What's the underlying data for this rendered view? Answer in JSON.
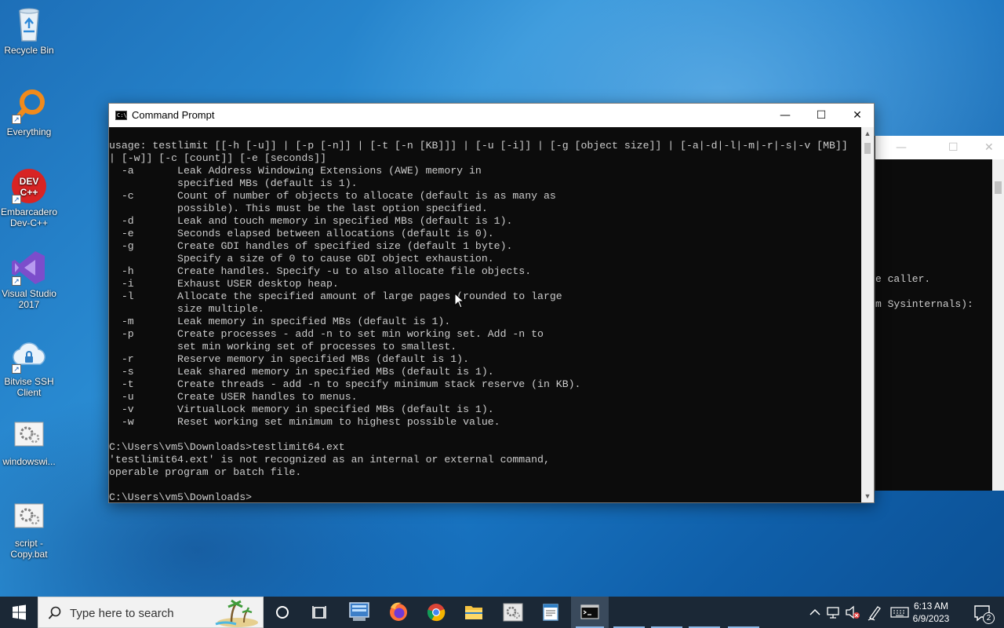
{
  "desktop": {
    "icons": [
      {
        "label": "Recycle Bin",
        "icon": "recycle-bin-icon"
      },
      {
        "label": "Everything",
        "icon": "everything-search-icon"
      },
      {
        "label": "Embarcadero Dev-C++",
        "icon": "dev-cpp-icon",
        "badge": "DEV C++"
      },
      {
        "label": "Visual Studio 2017",
        "icon": "visual-studio-icon"
      },
      {
        "label": "Bitvise SSH Client",
        "icon": "bitvise-ssh-icon"
      },
      {
        "label": "windowswi...",
        "icon": "batch-file-icon"
      },
      {
        "label": "script - Copy.bat",
        "icon": "batch-file-icon"
      }
    ]
  },
  "background_window": {
    "minimize_glyph": "—",
    "maximize_glyph": "☐",
    "close_glyph": "✕",
    "visible_text": [
      "e caller.",
      "m Sysinternals):"
    ]
  },
  "cmd_window": {
    "title": "Command Prompt",
    "minimize_glyph": "—",
    "maximize_glyph": "☐",
    "close_glyph": "✕",
    "lines": [
      "usage: testlimit [[-h [-u]] | [-p [-n]] | [-t [-n [KB]]] | [-u [-i]] | [-g [object size]] | [-a|-d|-l|-m|-r|-s|-v [MB]]",
      "| [-w]] [-c [count]] [-e [seconds]]",
      "  -a       Leak Address Windowing Extensions (AWE) memory in",
      "           specified MBs (default is 1).",
      "  -c       Count of number of objects to allocate (default is as many as",
      "           possible). This must be the last option specified.",
      "  -d       Leak and touch memory in specified MBs (default is 1).",
      "  -e       Seconds elapsed between allocations (default is 0).",
      "  -g       Create GDI handles of specified size (default 1 byte).",
      "           Specify a size of 0 to cause GDI object exhaustion.",
      "  -h       Create handles. Specify -u to also allocate file objects.",
      "  -i       Exhaust USER desktop heap.",
      "  -l       Allocate the specified amount of large pages (rounded to large",
      "           size multiple.",
      "  -m       Leak memory in specified MBs (default is 1).",
      "  -p       Create processes - add -n to set min working set. Add -n to",
      "           set min working set of processes to smallest.",
      "  -r       Reserve memory in specified MBs (default is 1).",
      "  -s       Leak shared memory in specified MBs (default is 1).",
      "  -t       Create threads - add -n to specify minimum stack reserve (in KB).",
      "  -u       Create USER handles to menus.",
      "  -v       VirtualLock memory in specified MBs (default is 1).",
      "  -w       Reset working set minimum to highest possible value.",
      "",
      "C:\\Users\\vm5\\Downloads>testlimit64.ext",
      "'testlimit64.ext' is not recognized as an internal or external command,",
      "operable program or batch file.",
      "",
      "C:\\Users\\vm5\\Downloads>"
    ]
  },
  "taskbar": {
    "search_placeholder": "Type here to search",
    "apps": [
      {
        "name": "cortana-icon"
      },
      {
        "name": "task-view-icon"
      },
      {
        "name": "network-app-icon"
      },
      {
        "name": "firefox-icon"
      },
      {
        "name": "chrome-icon"
      },
      {
        "name": "file-explorer-icon"
      },
      {
        "name": "settings-app-icon"
      },
      {
        "name": "notepad-app-icon"
      },
      {
        "name": "command-prompt-icon",
        "active": true
      }
    ],
    "clock_time": "6:13 AM",
    "clock_date": "6/9/2023",
    "notification_count": "2"
  },
  "colors": {
    "console_bg": "#0c0c0c",
    "console_text": "#cccccc",
    "taskbar_bg": "#1b2836"
  }
}
